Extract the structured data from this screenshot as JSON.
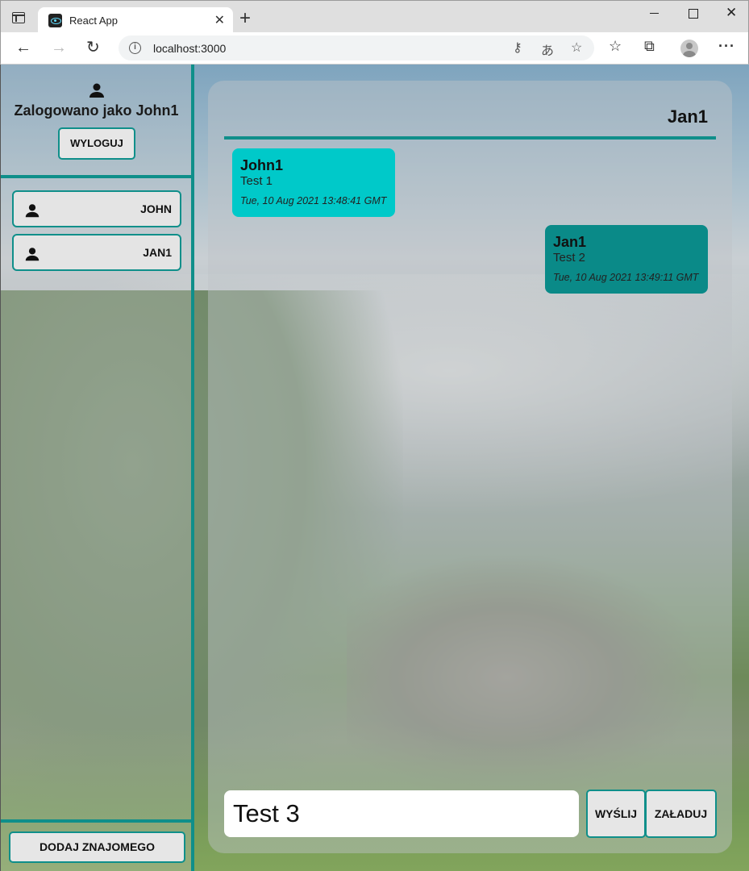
{
  "browser": {
    "tab_title": "React App",
    "tab_close": "✕",
    "new_tab": "+",
    "url": "localhost:3000",
    "window_close": "✕"
  },
  "sidebar": {
    "logged_in_text": "Zalogowano jako John1",
    "logout_label": "WYLOGUJ",
    "friends": [
      {
        "label": "JOHN"
      },
      {
        "label": "JAN1"
      }
    ],
    "add_friend_label": "DODAJ ZNAJOMEGO"
  },
  "chat": {
    "title": "Jan1",
    "messages": [
      {
        "author": "John1",
        "text": "Test 1",
        "time": "Tue, 10 Aug 2021 13:48:41 GMT",
        "direction": "incoming"
      },
      {
        "author": "Jan1",
        "text": "Test 2",
        "time": "Tue, 10 Aug 2021 13:49:11 GMT",
        "direction": "outgoing"
      }
    ],
    "input_value": "Test 3",
    "send_label": "WYŚLIJ",
    "load_label": "ZAŁADUJ"
  },
  "colors": {
    "accent": "#0f8f8a",
    "incoming_bubble": "#00c9c9",
    "outgoing_bubble": "#0a8a88"
  },
  "icons": {
    "user": "person-icon",
    "back": "arrow-left-icon",
    "forward": "arrow-right-icon",
    "reload": "reload-icon"
  }
}
